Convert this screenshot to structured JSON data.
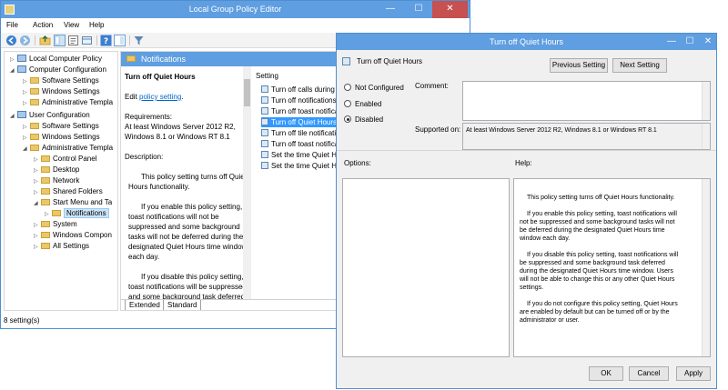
{
  "main_window": {
    "title": "Local Group Policy Editor",
    "controls": {
      "minimize": "—",
      "maximize": "☐",
      "close": "✕"
    },
    "menu": [
      "File",
      "Action",
      "View",
      "Help"
    ],
    "toolbar_icons": [
      "back-arrow-icon",
      "forward-arrow-icon",
      "up-folder-icon",
      "show-tree-icon",
      "properties-icon",
      "export-icon",
      "help-icon",
      "show-hide-icon",
      "filter-icon"
    ],
    "tree": [
      {
        "label": "Local Computer Policy",
        "icon": "computer-icon"
      },
      {
        "label": "Computer Configuration",
        "icon": "computer-icon",
        "expanded": true
      },
      {
        "label": "Software Settings",
        "icon": "folder-icon"
      },
      {
        "label": "Windows Settings",
        "icon": "folder-icon"
      },
      {
        "label": "Administrative Templa",
        "icon": "folder-icon"
      },
      {
        "label": "User Configuration",
        "icon": "user-icon",
        "expanded": true
      },
      {
        "label": "Software Settings",
        "icon": "folder-icon"
      },
      {
        "label": "Windows Settings",
        "icon": "folder-icon"
      },
      {
        "label": "Administrative Templa",
        "icon": "folder-icon",
        "expanded": true
      },
      {
        "label": "Control Panel",
        "icon": "folder-icon"
      },
      {
        "label": "Desktop",
        "icon": "folder-icon"
      },
      {
        "label": "Network",
        "icon": "folder-icon"
      },
      {
        "label": "Shared Folders",
        "icon": "folder-icon"
      },
      {
        "label": "Start Menu and Ta",
        "icon": "folder-icon",
        "expanded": true
      },
      {
        "label": "Notifications",
        "icon": "folder-icon",
        "selected": true
      },
      {
        "label": "System",
        "icon": "folder-icon"
      },
      {
        "label": "Windows Compon",
        "icon": "folder-icon"
      },
      {
        "label": "All Settings",
        "icon": "folder-icon"
      }
    ],
    "pane_header": "Notifications",
    "description": {
      "title": "Turn off Quiet Hours",
      "edit_prefix": "Edit ",
      "edit_link": "policy setting",
      "edit_suffix": ".",
      "requirements_label": "Requirements:",
      "requirements_text": "At least Windows Server 2012 R2, Windows 8.1 or Windows RT 8.1",
      "description_label": "Description:",
      "para1": "This policy setting turns off Quiet Hours functionality.",
      "para2": "If you enable this policy setting, toast notifications will not be suppressed and some background tasks will not be deferred during the designated Quiet Hours time window each day.",
      "para3": "If you disable this policy setting, toast notifications will be suppressed and some background task deferred during the"
    },
    "list_header": "Setting",
    "settings": [
      "Turn off calls during Q",
      "Turn off notifications d",
      "Turn off toast notificat",
      "Turn off Quiet Hours",
      "Turn off tile notificati",
      "Turn off toast notificat",
      "Set the time Quiet Hou",
      "Set the time Quiet Hou"
    ],
    "selected_setting_index": 3,
    "tabs": [
      "Extended",
      "Standard"
    ],
    "status": "8 setting(s)"
  },
  "dialog": {
    "title": "Turn off Quiet Hours",
    "controls": {
      "minimize": "—",
      "maximize": "☐",
      "close": "✕"
    },
    "header": "Turn off Quiet Hours",
    "prev_button": "Previous Setting",
    "next_button": "Next Setting",
    "options": [
      "Not Configured",
      "Enabled",
      "Disabled"
    ],
    "selected_option": "Disabled",
    "comment_label": "Comment:",
    "supported_label": "Supported on:",
    "supported_value": "At least Windows Server 2012 R2, Windows 8.1 or Windows RT 8.1",
    "options_label": "Options:",
    "help_label": "Help:",
    "help_paragraphs": [
      "This policy setting turns off Quiet Hours functionality.",
      "If you enable this policy setting, toast notifications will not be suppressed and some background tasks will not be deferred during the designated Quiet Hours time window each day.",
      "If you disable this policy setting, toast notifications will be suppressed and some background task deferred during the designated Quiet Hours time window.  Users will not be able to change this or any other Quiet Hours settings.",
      "If you do not configure this policy setting, Quiet Hours are enabled by default but can be turned off or by the administrator or user."
    ],
    "ok_button": "OK",
    "cancel_button": "Cancel",
    "apply_button": "Apply"
  },
  "colors": {
    "titlebar": "#5f9ee0",
    "close_button": "#c75050",
    "selection": "#3399ff",
    "link": "#0066cc"
  }
}
